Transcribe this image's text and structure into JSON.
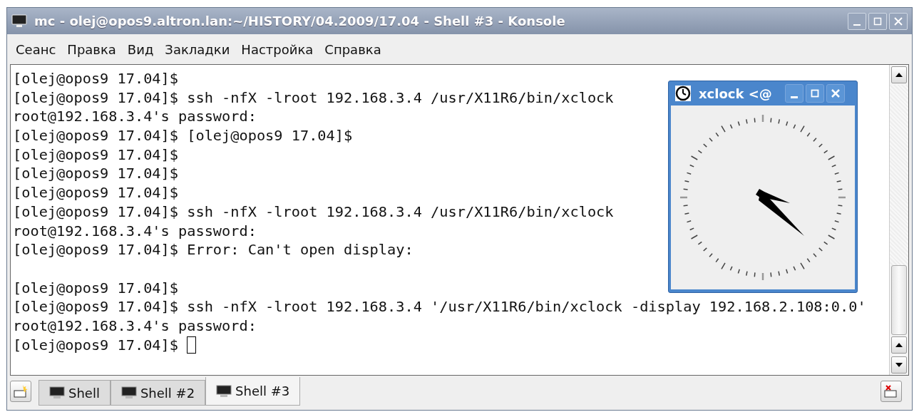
{
  "window": {
    "title": "mc - olej@opos9.altron.lan:~/HISTORY/04.2009/17.04 - Shell #3 - Konsole"
  },
  "menu": [
    "Сеанс",
    "Правка",
    "Вид",
    "Закладки",
    "Настройка",
    "Справка"
  ],
  "terminal": {
    "lines": [
      {
        "kind": "text",
        "text": "[olej@opos9 17.04]$"
      },
      {
        "kind": "text",
        "text": "[olej@opos9 17.04]$ ssh -nfX -lroot 192.168.3.4 /usr/X11R6/bin/xclock"
      },
      {
        "kind": "text",
        "text": "root@192.168.3.4's password:"
      },
      {
        "kind": "text",
        "text": "[olej@opos9 17.04]$ [olej@opos9 17.04]$"
      },
      {
        "kind": "text",
        "text": "[olej@opos9 17.04]$"
      },
      {
        "kind": "text",
        "text": "[olej@opos9 17.04]$"
      },
      {
        "kind": "text",
        "text": "[olej@opos9 17.04]$"
      },
      {
        "kind": "text",
        "text": "[olej@opos9 17.04]$ ssh -nfX -lroot 192.168.3.4 /usr/X11R6/bin/xclock"
      },
      {
        "kind": "text",
        "text": "root@192.168.3.4's password:"
      },
      {
        "kind": "text",
        "text": "[olej@opos9 17.04]$ Error: Can't open display:"
      },
      {
        "kind": "blank"
      },
      {
        "kind": "text",
        "text": "[olej@opos9 17.04]$"
      },
      {
        "kind": "text",
        "text": "[olej@opos9 17.04]$ ssh -nfX -lroot 192.168.3.4 '/usr/X11R6/bin/xclock -display 192.168.2.108:0.0'"
      },
      {
        "kind": "text",
        "text": "root@192.168.3.4's password:"
      },
      {
        "kind": "text",
        "text": "[olej@opos9 17.04]$",
        "cursor": true
      }
    ]
  },
  "xclock": {
    "title": "xclock <@"
  },
  "tabs": [
    {
      "label": "Shell",
      "selected": false
    },
    {
      "label": "Shell #2",
      "selected": false
    },
    {
      "label": "Shell #3",
      "selected": true
    }
  ]
}
